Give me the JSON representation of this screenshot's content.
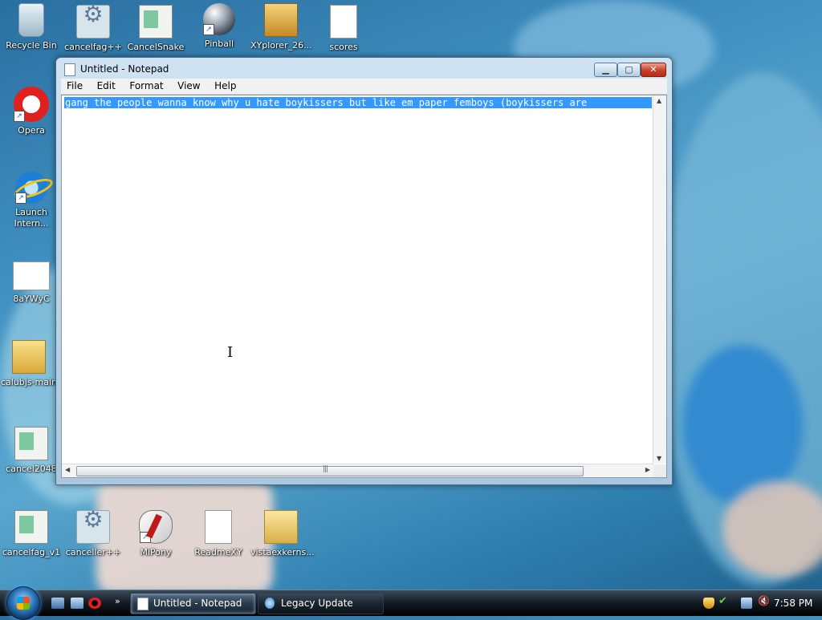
{
  "desktop_icons": [
    {
      "label": "Recycle Bin",
      "icon": "recycle-bin-icon"
    },
    {
      "label": "cancelfag++",
      "icon": "gear-icon"
    },
    {
      "label": "CancelSnake",
      "icon": "window-icon"
    },
    {
      "label": "Pinball",
      "icon": "pinball-icon"
    },
    {
      "label": "XYplorer_26...",
      "icon": "installer-box-icon"
    },
    {
      "label": "scores",
      "icon": "text-file-icon"
    },
    {
      "label": "Opera",
      "icon": "opera-icon"
    },
    {
      "label": "Launch Intern...",
      "icon": "internet-explorer-icon"
    },
    {
      "label": "8aYWyC",
      "icon": "image-file-icon"
    },
    {
      "label": "calubjs-main",
      "icon": "zip-folder-icon"
    },
    {
      "label": "cancel2048",
      "icon": "window-icon"
    },
    {
      "label": "cancelfag_v1",
      "icon": "window-icon"
    },
    {
      "label": "canceller++",
      "icon": "gear-icon"
    },
    {
      "label": "MiPony",
      "icon": "mipony-icon"
    },
    {
      "label": "ReadmeXY",
      "icon": "text-file-icon"
    },
    {
      "label": "vistaexkerns...",
      "icon": "folder-icon"
    }
  ],
  "notepad": {
    "title": "Untitled - Notepad",
    "buttons": {
      "minimize": "▁",
      "maximize": "▢",
      "close": "✕"
    },
    "menu": [
      "File",
      "Edit",
      "Format",
      "View",
      "Help"
    ],
    "content": "gang the people wanna know why u hate boykissers but like em paper femboys (boykissers are",
    "content_selected": true
  },
  "taskbar": {
    "quick_launch_more": "»",
    "buttons": [
      {
        "label": "Untitled - Notepad",
        "active": true
      },
      {
        "label": "Legacy Update",
        "active": false
      }
    ],
    "clock": "7:58 PM"
  },
  "colors": {
    "selection": "#3399ff",
    "close_button": "#c8402a",
    "taskbar": "#121a22"
  }
}
